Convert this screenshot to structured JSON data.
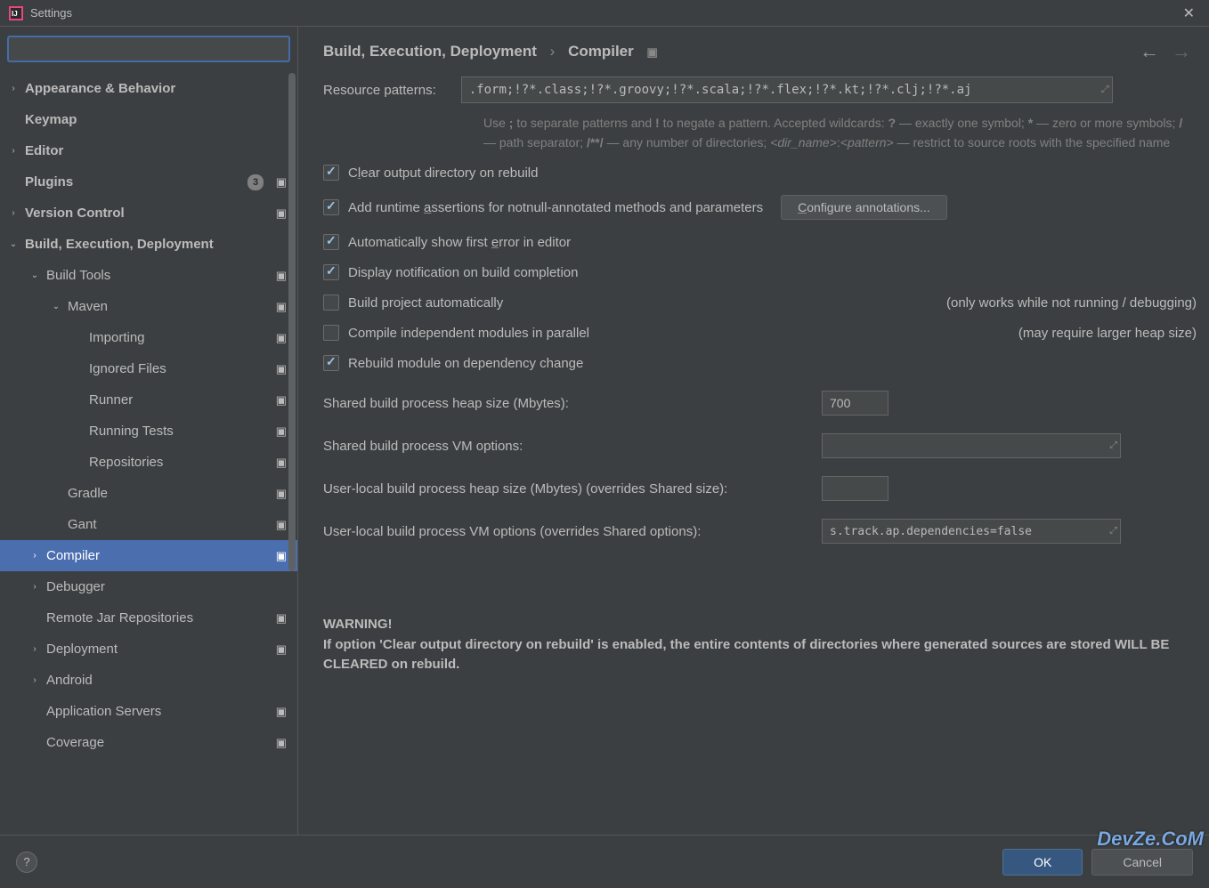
{
  "window": {
    "title": "Settings"
  },
  "search": {
    "placeholder": ""
  },
  "sidebar": {
    "items": [
      {
        "label": "Appearance & Behavior",
        "level": 0,
        "expandable": true,
        "expanded": false
      },
      {
        "label": "Keymap",
        "level": 0,
        "expandable": false
      },
      {
        "label": "Editor",
        "level": 0,
        "expandable": true,
        "expanded": false
      },
      {
        "label": "Plugins",
        "level": 0,
        "expandable": false,
        "badge": "3",
        "proj": true
      },
      {
        "label": "Version Control",
        "level": 0,
        "expandable": true,
        "expanded": false,
        "proj": true
      },
      {
        "label": "Build, Execution, Deployment",
        "level": 0,
        "expandable": true,
        "expanded": true
      },
      {
        "label": "Build Tools",
        "level": 1,
        "expandable": true,
        "expanded": true,
        "proj": true
      },
      {
        "label": "Maven",
        "level": 2,
        "expandable": true,
        "expanded": true,
        "proj": true
      },
      {
        "label": "Importing",
        "level": 3,
        "proj": true
      },
      {
        "label": "Ignored Files",
        "level": 3,
        "proj": true
      },
      {
        "label": "Runner",
        "level": 3,
        "proj": true
      },
      {
        "label": "Running Tests",
        "level": 3,
        "proj": true
      },
      {
        "label": "Repositories",
        "level": 3,
        "proj": true
      },
      {
        "label": "Gradle",
        "level": 2,
        "proj": true
      },
      {
        "label": "Gant",
        "level": 2,
        "proj": true
      },
      {
        "label": "Compiler",
        "level": 1,
        "expandable": true,
        "expanded": false,
        "proj": true,
        "selected": true
      },
      {
        "label": "Debugger",
        "level": 1,
        "expandable": true,
        "expanded": false
      },
      {
        "label": "Remote Jar Repositories",
        "level": 1,
        "proj": true
      },
      {
        "label": "Deployment",
        "level": 1,
        "expandable": true,
        "expanded": false,
        "proj": true
      },
      {
        "label": "Android",
        "level": 1,
        "expandable": true,
        "expanded": false
      },
      {
        "label": "Application Servers",
        "level": 1,
        "proj": true
      },
      {
        "label": "Coverage",
        "level": 1,
        "proj": true
      }
    ]
  },
  "breadcrumb": {
    "parent": "Build, Execution, Deployment",
    "current": "Compiler"
  },
  "form": {
    "resource_label": "Resource patterns:",
    "resource_value": ".form;!?*.class;!?*.groovy;!?*.scala;!?*.flex;!?*.kt;!?*.clj;!?*.aj",
    "hint": "Use ; to separate patterns and ! to negate a pattern. Accepted wildcards: ? — exactly one symbol; * — zero or more symbols; / — path separator; /**/ — any number of directories; <dir_name>:<pattern> — restrict to source roots with the specified name",
    "cb_clear": "Clear output directory on rebuild",
    "cb_assert": "Add runtime assertions for notnull-annotated methods and parameters",
    "btn_config": "Configure annotations...",
    "cb_auto_err": "Automatically show first error in editor",
    "cb_notify": "Display notification on build completion",
    "cb_auto_build": "Build project automatically",
    "note_auto_build": "(only works while not running / debugging)",
    "cb_parallel": "Compile independent modules in parallel",
    "note_parallel": "(may require larger heap size)",
    "cb_rebuild": "Rebuild module on dependency change",
    "heap_label": "Shared build process heap size (Mbytes):",
    "heap_value": "700",
    "vm_label": "Shared build process VM options:",
    "vm_value": "",
    "local_heap_label": "User-local build process heap size (Mbytes) (overrides Shared size):",
    "local_heap_value": "",
    "local_vm_label": "User-local build process VM options (overrides Shared options):",
    "local_vm_value": "s.track.ap.dependencies=false",
    "warning_title": "WARNING!",
    "warning_body": "If option 'Clear output directory on rebuild' is enabled, the entire contents of directories where generated sources are stored WILL BE CLEARED on rebuild."
  },
  "footer": {
    "ok": "OK",
    "cancel": "Cancel"
  },
  "watermark": "DevZe.CoM"
}
